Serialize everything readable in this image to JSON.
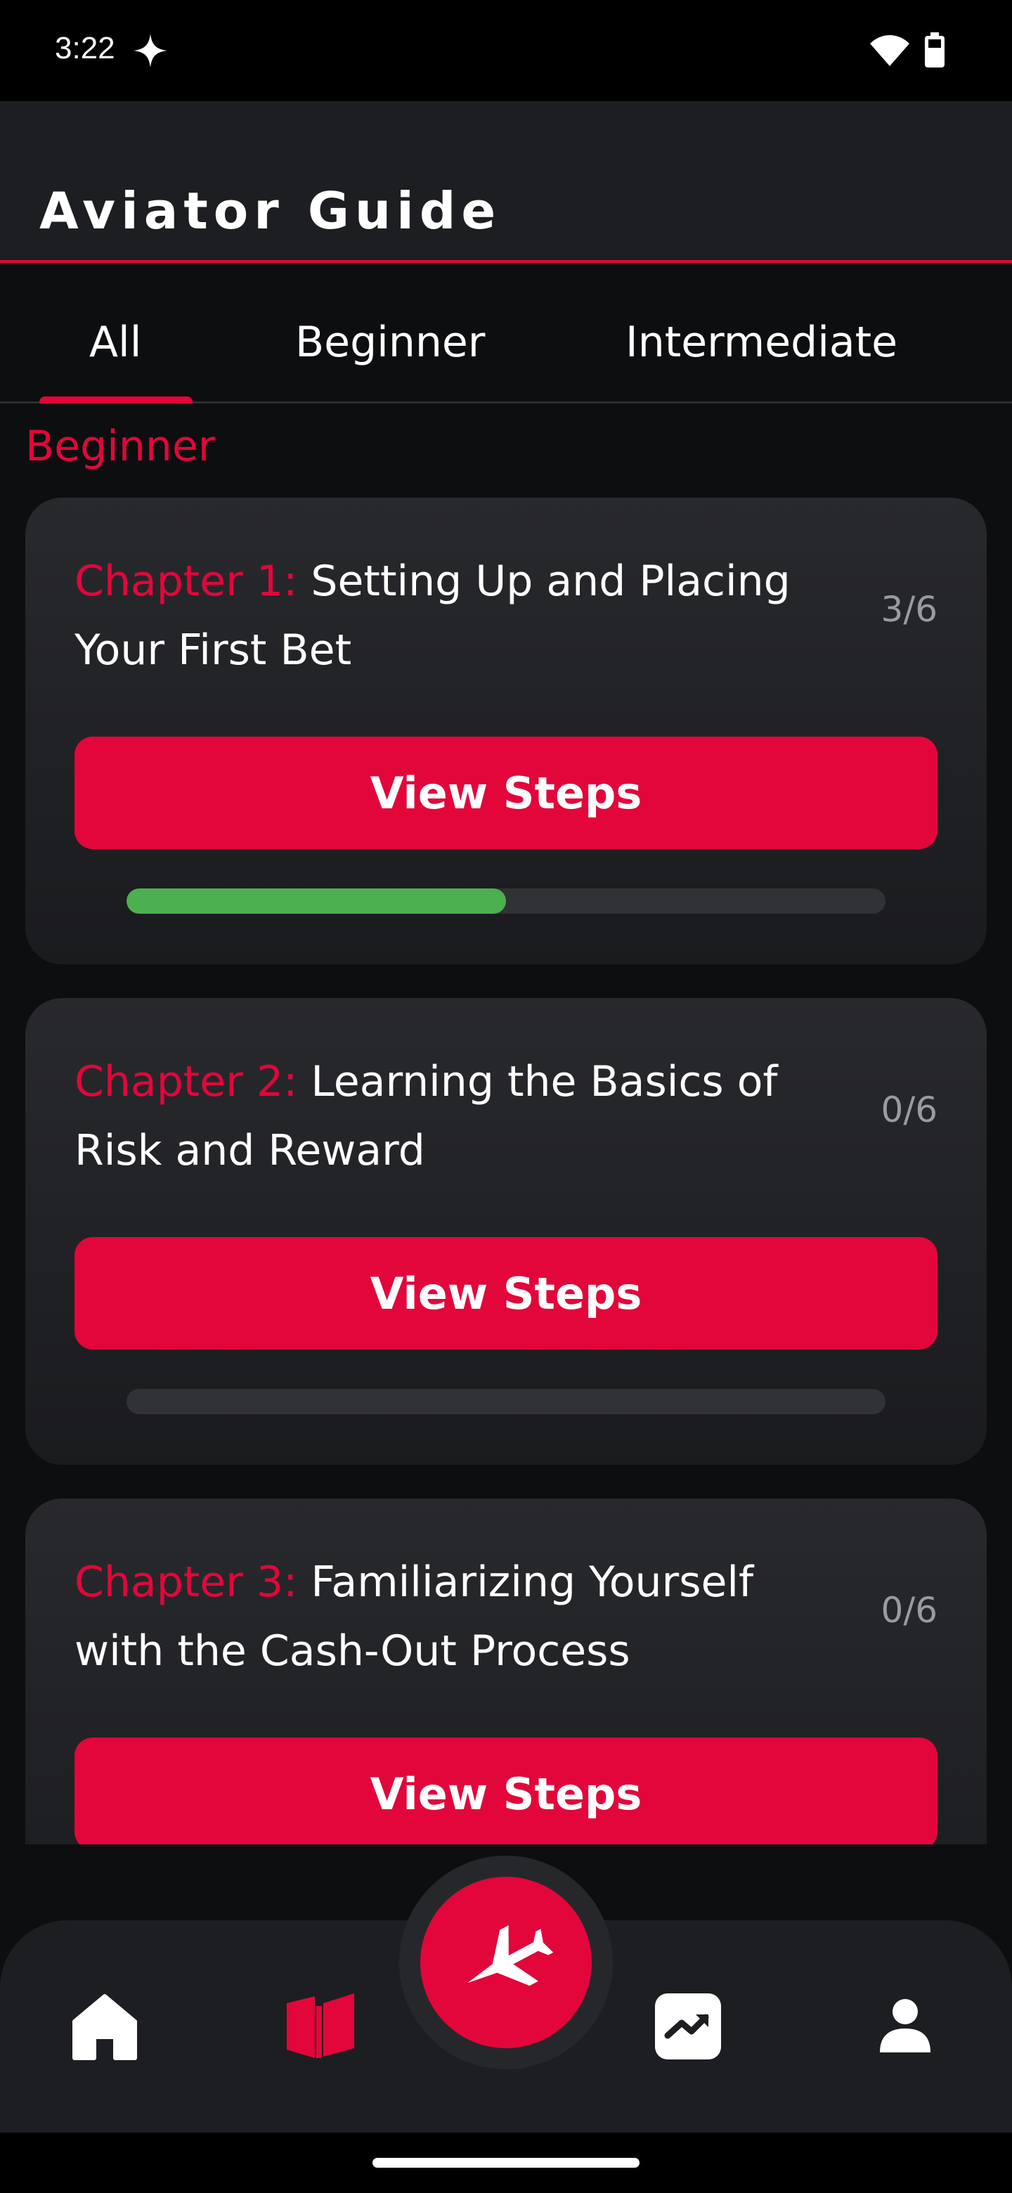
{
  "status_bar": {
    "time": "3:22"
  },
  "header": {
    "title": "Aviator Guide"
  },
  "tabs": [
    {
      "label": "All",
      "selected": true
    },
    {
      "label": "Beginner",
      "selected": false
    },
    {
      "label": "Intermediate",
      "selected": false
    }
  ],
  "section": {
    "heading": "Beginner"
  },
  "chapters": [
    {
      "prefix": "Chapter 1:",
      "title": "Setting Up and Placing Your First Bet",
      "count": "3/6",
      "button_label": "View Steps",
      "progress": 0.5
    },
    {
      "prefix": "Chapter 2:",
      "title": "Learning the Basics of Risk and Reward",
      "count": "0/6",
      "button_label": "View Steps",
      "progress": 0
    },
    {
      "prefix": "Chapter 3:",
      "title": "Familiarizing Yourself with the Cash-Out Process",
      "count": "0/6",
      "button_label": "View Steps",
      "progress": 0
    }
  ],
  "bottom_nav": {
    "items": [
      {
        "icon": "home-icon",
        "active": false
      },
      {
        "icon": "book-icon",
        "active": true
      },
      {
        "icon": "plane-icon",
        "active": false
      },
      {
        "icon": "trend-icon",
        "active": false
      },
      {
        "icon": "person-icon",
        "active": false
      }
    ]
  },
  "colors": {
    "accent": "#e3063a",
    "progress": "#4caf50",
    "background": "#0d0e10",
    "card": "#28292d"
  }
}
